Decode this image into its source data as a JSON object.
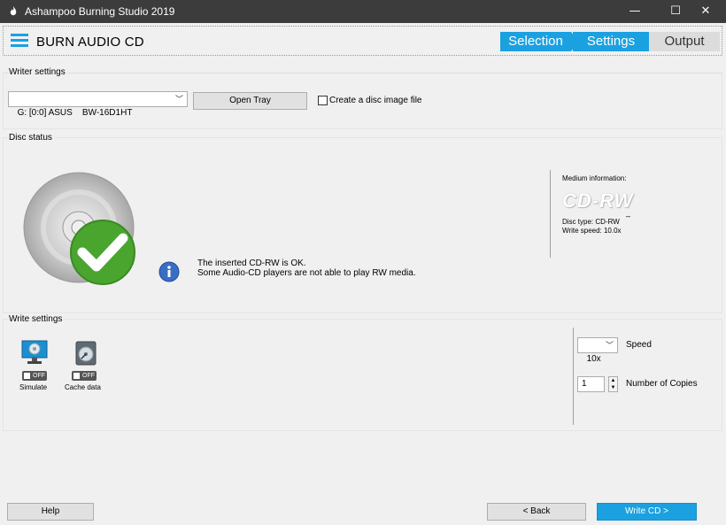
{
  "window": {
    "title": "Ashampoo Burning Studio 2019",
    "controls": {
      "minimize": "—",
      "maximize": "☐",
      "close": "✕"
    }
  },
  "header": {
    "title": "BURN AUDIO CD",
    "steps": [
      "Selection",
      "Settings",
      "Output"
    ],
    "active_step": "Settings",
    "accent_color": "#1ca1e0"
  },
  "writer_settings": {
    "label": "Writer settings",
    "drive_value": "G: [0:0] ASUS    BW-16D1HT",
    "open_tray_label": "Open Tray",
    "disc_image_label": "Create a disc image file",
    "disc_image_checked": false
  },
  "disc_status": {
    "label": "Disc status",
    "message_line1": "The inserted CD-RW is OK.",
    "message_line2": "Some Audio-CD players are not able to play RW media.",
    "medium_info_label": "Medium information:",
    "medium_logo": "CD-RW",
    "medium_dash": "–",
    "disc_type": "Disc type: CD-RW",
    "write_speed": "Write speed: 10.0x"
  },
  "write_settings": {
    "label": "Write settings",
    "simulate": {
      "label": "Simulate",
      "toggle": "OFF"
    },
    "cache": {
      "label": "Cache data",
      "toggle": "OFF"
    },
    "speed_value": "10x",
    "speed_label": "Speed",
    "copies_value": "1",
    "copies_label": "Number of Copies"
  },
  "footer": {
    "help_label": "Help",
    "back_label": "< Back",
    "write_label": "Write CD >"
  }
}
